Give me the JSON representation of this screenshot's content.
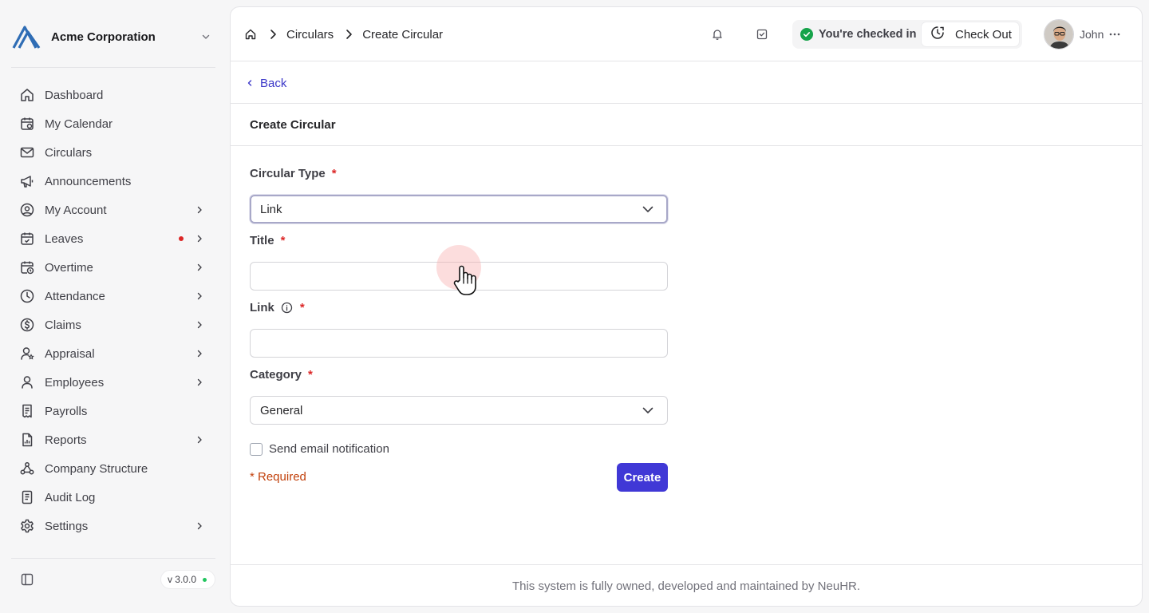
{
  "org": {
    "name": "Acme Corporation"
  },
  "sidebar": {
    "items": [
      {
        "label": "Dashboard",
        "icon": "home-icon",
        "has_chevron": false
      },
      {
        "label": "My Calendar",
        "icon": "calendar-icon",
        "has_chevron": false
      },
      {
        "label": "Circulars",
        "icon": "mail-icon",
        "has_chevron": false
      },
      {
        "label": "Announcements",
        "icon": "megaphone-icon",
        "has_chevron": false
      },
      {
        "label": "My Account",
        "icon": "user-circle-icon",
        "has_chevron": true
      },
      {
        "label": "Leaves",
        "icon": "calendar-check-icon",
        "has_chevron": true,
        "has_dot": true
      },
      {
        "label": "Overtime",
        "icon": "calendar-clock-icon",
        "has_chevron": true
      },
      {
        "label": "Attendance",
        "icon": "clock-icon",
        "has_chevron": true
      },
      {
        "label": "Claims",
        "icon": "dollar-circle-icon",
        "has_chevron": true
      },
      {
        "label": "Appraisal",
        "icon": "user-star-icon",
        "has_chevron": true
      },
      {
        "label": "Employees",
        "icon": "user-icon",
        "has_chevron": true
      },
      {
        "label": "Payrolls",
        "icon": "receipt-icon",
        "has_chevron": false
      },
      {
        "label": "Reports",
        "icon": "report-icon",
        "has_chevron": true
      },
      {
        "label": "Company Structure",
        "icon": "hierarchy-icon",
        "has_chevron": false
      },
      {
        "label": "Audit Log",
        "icon": "log-icon",
        "has_chevron": false
      },
      {
        "label": "Settings",
        "icon": "gear-icon",
        "has_chevron": true
      }
    ],
    "version": "v 3.0.0"
  },
  "breadcrumb": {
    "items": [
      "Circulars",
      "Create Circular"
    ]
  },
  "checkin": {
    "status": "You're checked in",
    "button": "Check Out"
  },
  "user": {
    "name": "John"
  },
  "back": {
    "label": "Back"
  },
  "page": {
    "title": "Create Circular"
  },
  "form": {
    "circular_type": {
      "label": "Circular Type",
      "value": "Link"
    },
    "title": {
      "label": "Title",
      "value": ""
    },
    "link": {
      "label": "Link",
      "value": ""
    },
    "category": {
      "label": "Category",
      "value": "General"
    },
    "email_notification": {
      "label": "Send email notification",
      "checked": false
    },
    "required_note": "* Required",
    "submit": "Create",
    "required_mark": "*"
  },
  "footer": {
    "text": "This system is fully owned, developed and maintained by NeuHR."
  },
  "colors": {
    "accent": "#4038d6",
    "link": "#3b37c8",
    "required": "#dc2626",
    "success": "#16a34a"
  }
}
